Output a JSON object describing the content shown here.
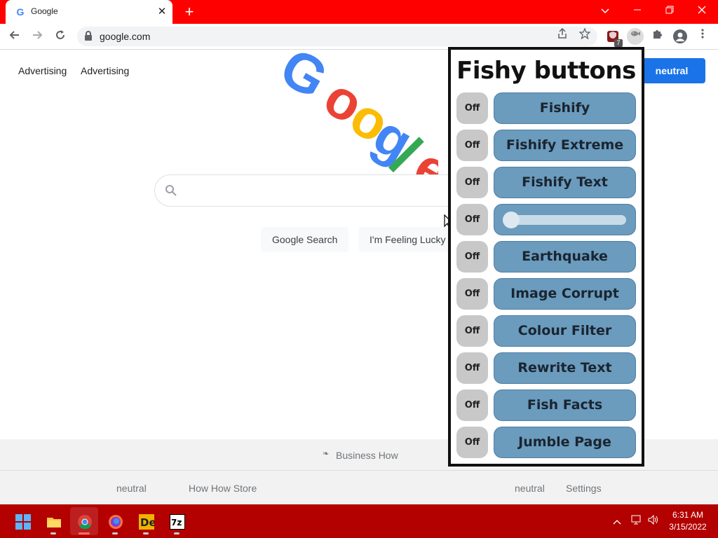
{
  "browser": {
    "tab_title": "Google",
    "favicon": "G",
    "close_glyph": "✕",
    "newtab_glyph": "+",
    "url": "google.com",
    "extension_badge": "7"
  },
  "page": {
    "top_links": [
      "Advertising",
      "Advertising"
    ],
    "signin_label": "neutral",
    "search_button": "Google Search",
    "lucky_button": "I'm Feeling Lucky",
    "location_text": "Business How",
    "footer_left": [
      "neutral",
      "How How Store"
    ],
    "footer_right": [
      "neutral",
      "Settings"
    ]
  },
  "popup": {
    "title": "Fishy buttons",
    "off_label": "Off",
    "buttons": [
      "Fishify",
      "Fishify Extreme",
      "Fishify Text",
      "",
      "Earthquake",
      "Image Corrupt",
      "Colour Filter",
      "Rewrite Text",
      "Fish Facts",
      "Jumble Page"
    ],
    "slider_value": 0
  },
  "taskbar": {
    "time": "6:31 AM",
    "date": "3/15/2022"
  },
  "colors": {
    "browser_frame": "#ff0000",
    "taskbar": "#b30000",
    "fishy_button": "#6b9bbd",
    "off_button": "#c8c8c8",
    "signin": "#1a73e8"
  }
}
